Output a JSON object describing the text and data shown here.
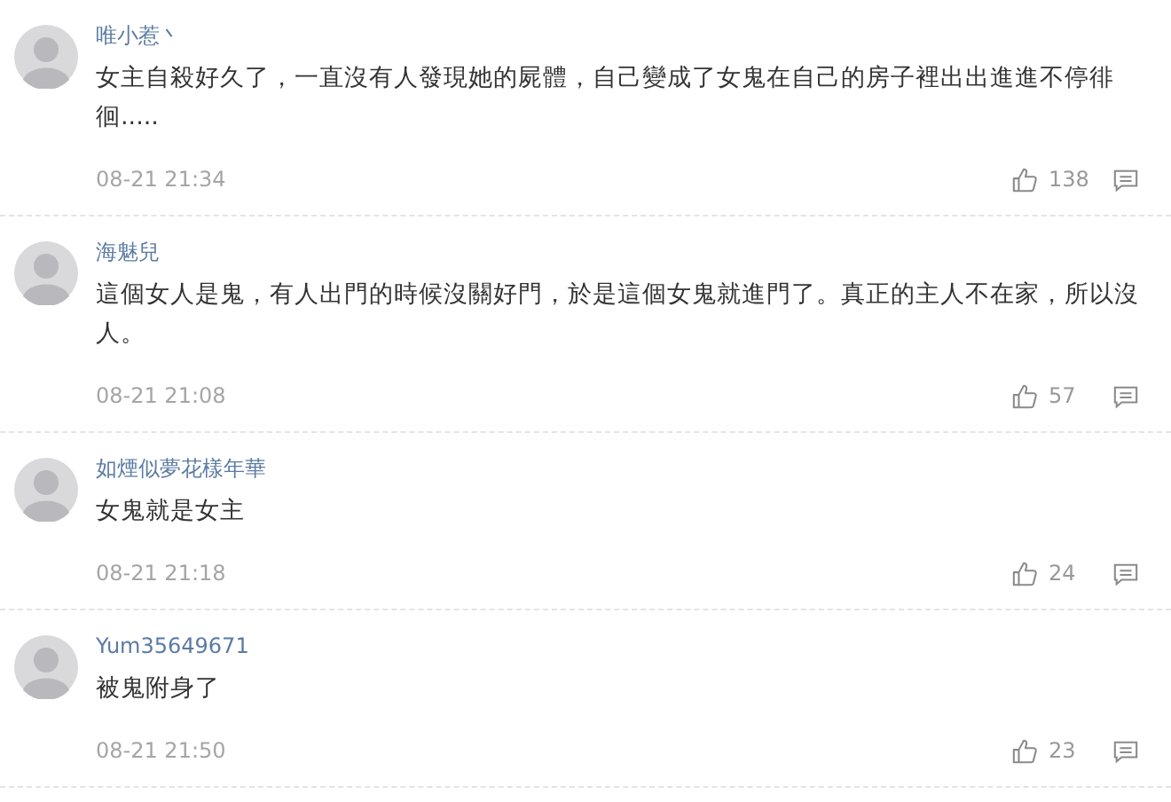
{
  "comments": [
    {
      "user": "唯小惹丶",
      "text": "女主自殺好久了，一直沒有人發現她的屍體，自己變成了女鬼在自己的房子裡出出進進不停徘徊.....",
      "time": "08-21 21:34",
      "likes": "138"
    },
    {
      "user": "海魅兒",
      "text": "這個女人是鬼，有人出門的時候沒關好門，於是這個女鬼就進門了。真正的主人不在家，所以沒人。",
      "time": "08-21 21:08",
      "likes": "57"
    },
    {
      "user": "如煙似夢花樣年華",
      "text": "女鬼就是女主",
      "time": "08-21 21:18",
      "likes": "24"
    },
    {
      "user": "Yum35649671",
      "text": "被鬼附身了",
      "time": "08-21 21:50",
      "likes": "23"
    }
  ]
}
